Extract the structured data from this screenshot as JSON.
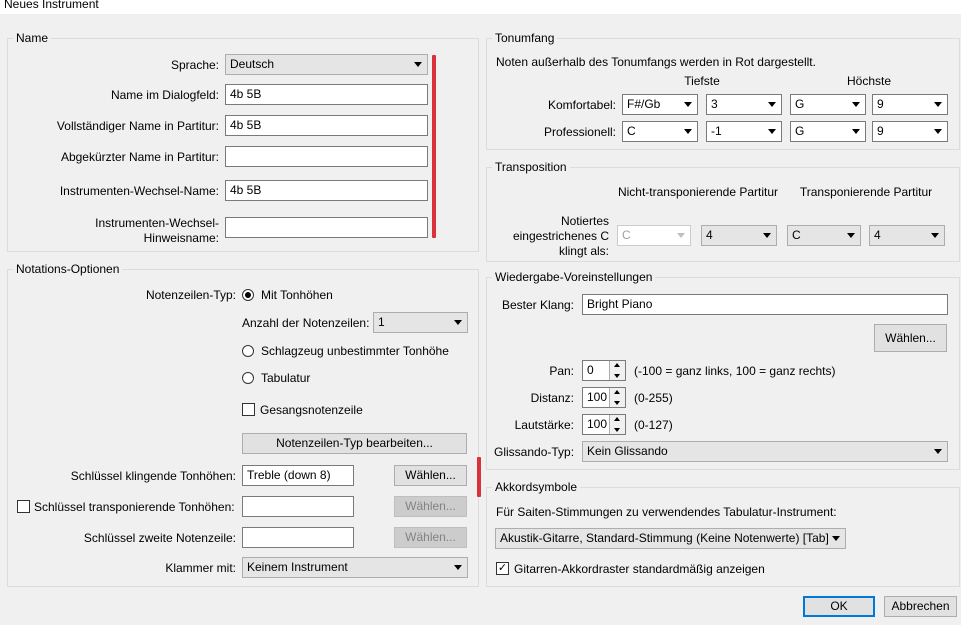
{
  "window": {
    "title": "Neues Instrument"
  },
  "colors": {
    "accent_red": "#d9323a",
    "default_button_border": "#0078d7"
  },
  "name_group": {
    "legend": "Name",
    "sprache_label": "Sprache:",
    "sprache_value": "Deutsch",
    "name_dialog_label": "Name im Dialogfeld:",
    "name_dialog_value": "4b 5B",
    "full_name_label": "Vollständiger Name in Partitur:",
    "full_name_value": "4b 5B",
    "short_name_label": "Abgekürzter Name in Partitur:",
    "short_name_value": "",
    "change_name_label": "Instrumenten-Wechsel-Name:",
    "change_name_value": "4b 5B",
    "change_hint_label_1": "Instrumenten-Wechsel-",
    "change_hint_label_2": "Hinweisname:",
    "change_hint_value": ""
  },
  "notation_group": {
    "legend": "Notations-Optionen",
    "staff_type_label": "Notenzeilen-Typ:",
    "radio_pitched": "Mit Tonhöhen",
    "staff_count_label": "Anzahl der Notenzeilen:",
    "staff_count_value": "1",
    "radio_percussion": "Schlagzeug unbestimmter Tonhöhe",
    "radio_tab": "Tabulatur",
    "vocal_staff_label": "Gesangsnotenzeile",
    "edit_staff_type_button": "Notenzeilen-Typ bearbeiten...",
    "clef_sounding_label": "Schlüssel klingende Tonhöhen:",
    "clef_sounding_value": "Treble (down 8)",
    "choose_button": "Wählen...",
    "clef_transposing_label": "Schlüssel transponierende Tonhöhen:",
    "clef_second_label": "Schlüssel zweite Notenzeile:",
    "bracket_label": "Klammer mit:",
    "bracket_value": "Keinem Instrument"
  },
  "range_group": {
    "legend": "Tonumfang",
    "info": "Noten außerhalb des Tonumfangs werden in Rot dargestellt.",
    "lowest_header": "Tiefste",
    "highest_header": "Höchste",
    "comfortable_label": "Komfortabel:",
    "comfortable": [
      "F#/Gb",
      "3",
      "G",
      "9"
    ],
    "professional_label": "Professionell:",
    "professional": [
      "C",
      "-1",
      "G",
      "9"
    ]
  },
  "transposition_group": {
    "legend": "Transposition",
    "non_transposing_header": "Nicht-transponierende Partitur",
    "transposing_header": "Transponierende Partitur",
    "written_c_label_1": "Notiertes",
    "written_c_label_2": "eingestrichenes C",
    "written_c_label_3": "klingt als:",
    "values": [
      "C",
      "4",
      "C",
      "4"
    ]
  },
  "playback_group": {
    "legend": "Wiedergabe-Voreinstellungen",
    "best_sound_label": "Bester Klang:",
    "best_sound_value": "Bright Piano",
    "choose_button": "Wählen...",
    "pan_label": "Pan:",
    "pan_value": "0",
    "pan_hint": "(-100 = ganz links, 100 = ganz rechts)",
    "distance_label": "Distanz:",
    "distance_value": "100",
    "distance_hint": "(0-255)",
    "volume_label": "Lautstärke:",
    "volume_value": "100",
    "volume_hint": "(0-127)",
    "glissando_label": "Glissando-Typ:",
    "glissando_value": "Kein Glissando"
  },
  "chord_group": {
    "legend": "Akkordsymbole",
    "tab_instrument_label": "Für Saiten-Stimmungen zu verwendendes Tabulatur-Instrument:",
    "tab_instrument_value": "Akustik-Gitarre, Standard-Stimmung (Keine Notenwerte) [Tab]",
    "show_chord_diagrams_label": "Gitarren-Akkordraster standardmäßig anzeigen"
  },
  "footer": {
    "ok_button": "OK",
    "cancel_button": "Abbrechen"
  }
}
